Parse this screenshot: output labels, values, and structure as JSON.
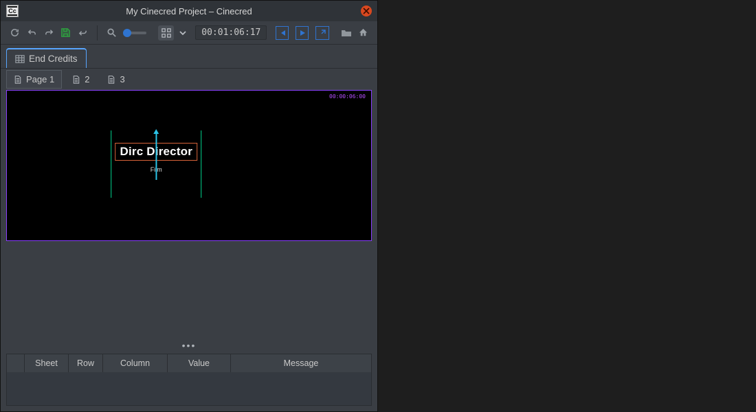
{
  "titlebar": {
    "title": "My Cinecred Project – Cinecred",
    "app_icon_label": "Cc"
  },
  "toolbar": {
    "timecode": "00:01:06:17"
  },
  "tabs1": {
    "end_credits": "End Credits"
  },
  "tabs2": {
    "page1": "Page 1",
    "page2": "2",
    "page3": "3"
  },
  "preview": {
    "overlay_tc": "00:00:06:00",
    "credit_main": "Dirc Director",
    "credit_sub": "Film"
  },
  "dots": "•••",
  "table": {
    "headers": {
      "sheet": "Sheet",
      "row": "Row",
      "column": "Column",
      "value": "Value",
      "message": "Message"
    }
  }
}
